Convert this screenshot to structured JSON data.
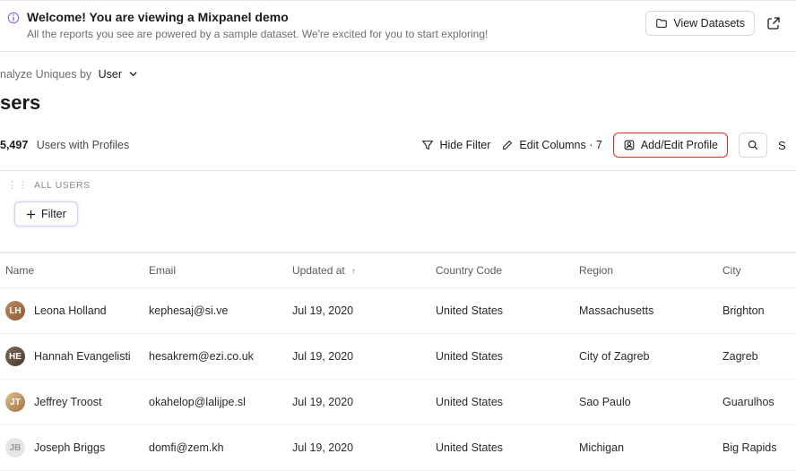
{
  "banner": {
    "title": "Welcome! You are viewing a Mixpanel demo",
    "subtitle": "All the reports you see are powered by a sample dataset. We're excited for you to start exploring!",
    "view_datasets": "View Datasets"
  },
  "analyze": {
    "label": "nalyze Uniques by",
    "value": "User"
  },
  "page_title": "sers",
  "count": {
    "number": "5,497",
    "label": "Users with Profiles"
  },
  "toolbar": {
    "hide_filter": "Hide Filter",
    "edit_columns": "Edit Columns · 7",
    "add_edit_profile": "Add/Edit Profile",
    "search_char": "S"
  },
  "all_users_label": "ALL USERS",
  "filter_chip": "Filter",
  "columns": {
    "name": "Name",
    "email": "Email",
    "updated_at": "Updated at",
    "country_code": "Country Code",
    "region": "Region",
    "city": "City"
  },
  "rows": [
    {
      "initials": "LH",
      "name": "Leona Holland",
      "email": "kephesaj@si.ve",
      "updated_at": "Jul 19, 2020",
      "country_code": "United States",
      "region": "Massachusetts",
      "city": "Brighton"
    },
    {
      "initials": "HE",
      "name": "Hannah Evangelisti",
      "email": "hesakrem@ezi.co.uk",
      "updated_at": "Jul 19, 2020",
      "country_code": "United States",
      "region": "City of Zagreb",
      "city": "Zagreb"
    },
    {
      "initials": "JT",
      "name": "Jeffrey Troost",
      "email": "okahelop@lalijpe.sl",
      "updated_at": "Jul 19, 2020",
      "country_code": "United States",
      "region": "Sao Paulo",
      "city": "Guarulhos"
    },
    {
      "initials": "JB",
      "name": "Joseph Briggs",
      "email": "domfi@zem.kh",
      "updated_at": "Jul 19, 2020",
      "country_code": "United States",
      "region": "Michigan",
      "city": "Big Rapids"
    }
  ]
}
